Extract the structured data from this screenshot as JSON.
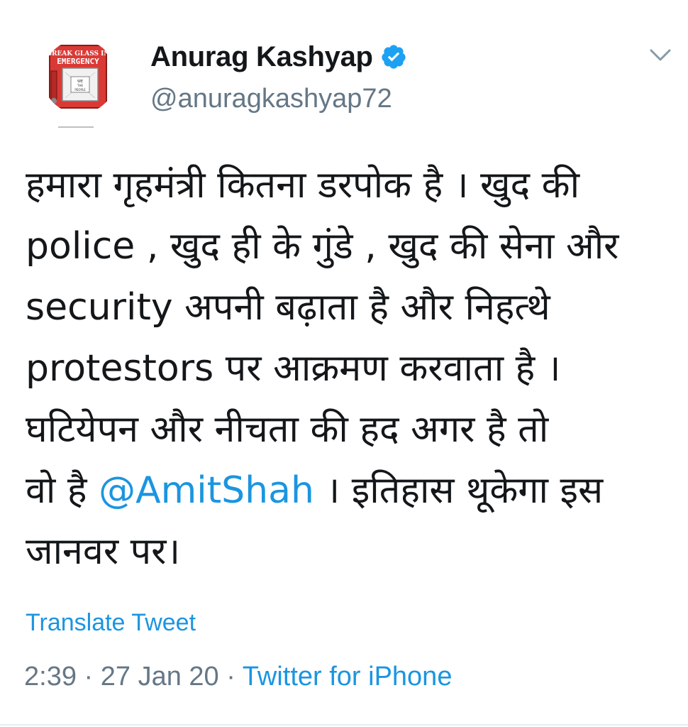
{
  "user": {
    "display_name": "Anurag Kashyap",
    "handle": "@anuragkashyap72",
    "avatar_text_line1": "BREAK GLASS IN",
    "avatar_text_line2": "EMERGENCY",
    "verified_icon": "verified-badge-icon",
    "verified_color": "#1da1f2"
  },
  "tweet": {
    "lines": [
      "हमारा गृहमंत्री कितना डरपोक है । खुद की",
      "police , खुद ही के गुंडे , खुद की सेना और",
      "security अपनी बढ़ाता है और निहत्थे",
      "protestors पर आक्रमण करवाता है ।",
      "घटियेपन और नीचता की हद अगर है तो"
    ],
    "line6_before": "वो है ",
    "mention": "@AmitShah",
    "line6_after": " । इतिहास थूकेगा इस",
    "line7": "जानवर पर।",
    "translate_label": "Translate Tweet"
  },
  "meta": {
    "time": "2:39",
    "separator": " · ",
    "date": "27 Jan 20",
    "source": "Twitter for iPhone"
  },
  "colors": {
    "link": "#1b95e0",
    "secondary_text": "#657786",
    "primary_text": "#14171a"
  }
}
